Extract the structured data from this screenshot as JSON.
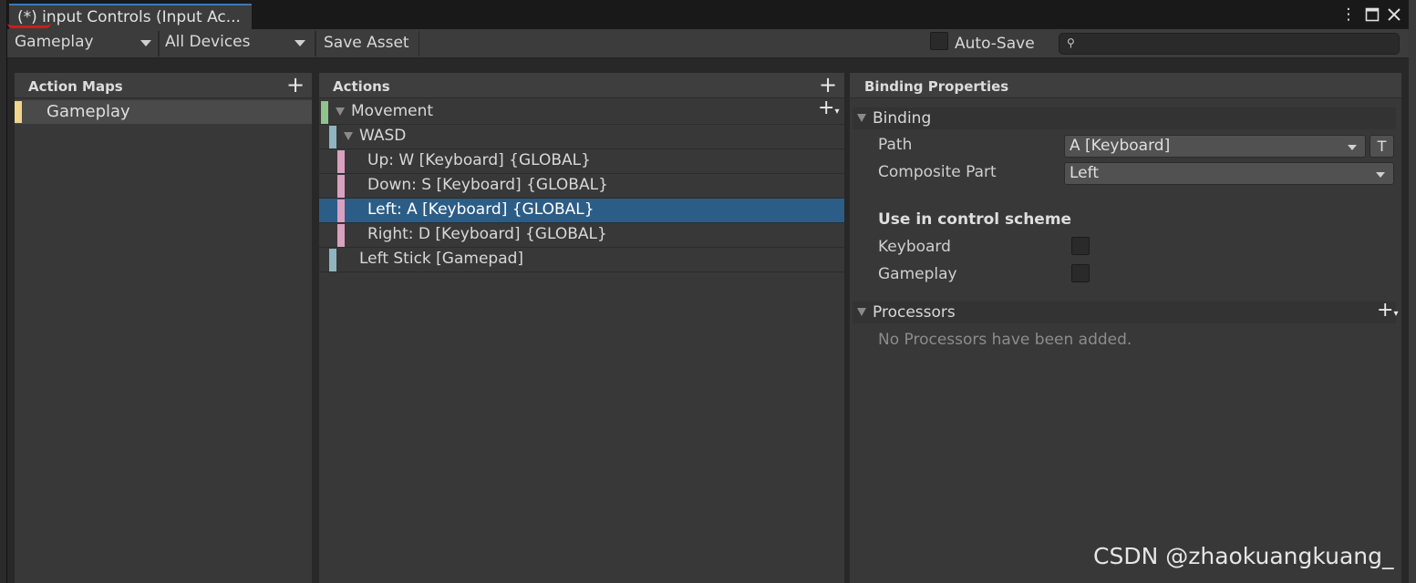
{
  "window": {
    "tab_title": "(*) input Controls (Input Ac...",
    "menu_icon": "kebab-menu-icon",
    "maximize_icon": "maximize-icon",
    "close_icon": "close-icon"
  },
  "toolbar": {
    "action_map_select": "Gameplay",
    "device_select": "All Devices",
    "save_label": "Save Asset",
    "autosave_label": "Auto-Save",
    "autosave_checked": false,
    "search_value": ""
  },
  "action_maps": {
    "header": "Action Maps",
    "items": [
      {
        "label": "Gameplay",
        "color": "#f1d58a"
      }
    ]
  },
  "actions": {
    "header": "Actions",
    "rows": [
      {
        "label": "Movement",
        "level": 0,
        "expandable": true,
        "color": "#8fc48f"
      },
      {
        "label": "WASD",
        "level": 1,
        "expandable": true,
        "color": "#8fb5c0"
      },
      {
        "label": "Up: W [Keyboard] {GLOBAL}",
        "level": 2,
        "expandable": false,
        "color": "#d9a0c0"
      },
      {
        "label": "Down: S [Keyboard] {GLOBAL}",
        "level": 2,
        "expandable": false,
        "color": "#d9a0c0"
      },
      {
        "label": "Left: A [Keyboard] {GLOBAL}",
        "level": 2,
        "expandable": false,
        "color": "#d9a0c0",
        "selected": true
      },
      {
        "label": "Right: D [Keyboard] {GLOBAL}",
        "level": 2,
        "expandable": false,
        "color": "#d9a0c0"
      },
      {
        "label": "Left Stick [Gamepad]",
        "level": 1,
        "expandable": false,
        "color": "#8fb5c0"
      }
    ]
  },
  "binding_properties": {
    "header": "Binding Properties",
    "binding_section": "Binding",
    "path_label": "Path",
    "path_value": "A [Keyboard]",
    "t_button": "T",
    "composite_label": "Composite Part",
    "composite_value": "Left",
    "scheme_title": "Use in control scheme",
    "schemes": [
      {
        "label": "Keyboard",
        "checked": false
      },
      {
        "label": "Gameplay",
        "checked": false
      }
    ],
    "processors_section": "Processors",
    "processors_empty": "No Processors have been added."
  },
  "watermark": "CSDN @zhaokuangkuang_",
  "colors": {
    "selection": "#2c5d87",
    "tab_accent": "#3a79bb",
    "annotation_red": "#d01c1c"
  }
}
